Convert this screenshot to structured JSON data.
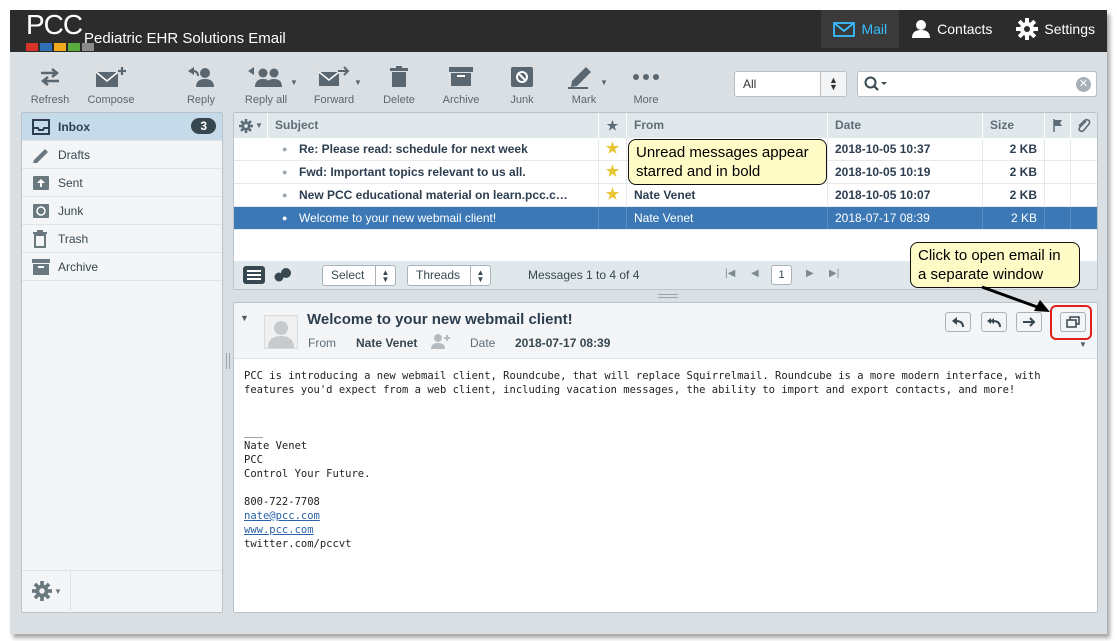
{
  "header": {
    "logo_text": "PCC",
    "logo_colors": [
      "#d9342b",
      "#2f6fb6",
      "#f0a81c",
      "#5aab3d",
      "#8a8a8a"
    ],
    "app_title": "Pediatric EHR Solutions Email",
    "nav": [
      {
        "label": "Mail",
        "icon": "envelope-icon",
        "active": true
      },
      {
        "label": "Contacts",
        "icon": "person-icon",
        "active": false
      },
      {
        "label": "Settings",
        "icon": "gear-icon",
        "active": false
      }
    ]
  },
  "toolbar": {
    "refresh": "Refresh",
    "compose": "Compose",
    "reply": "Reply",
    "reply_all": "Reply all",
    "forward": "Forward",
    "delete": "Delete",
    "archive": "Archive",
    "junk": "Junk",
    "mark": "Mark",
    "more": "More",
    "filter_value": "All",
    "search_value": ""
  },
  "sidebar": {
    "folders": [
      {
        "label": "Inbox",
        "icon": "inbox-icon",
        "unread": "3",
        "active": true
      },
      {
        "label": "Drafts",
        "icon": "pencil-icon"
      },
      {
        "label": "Sent",
        "icon": "sent-icon"
      },
      {
        "label": "Junk",
        "icon": "junk-icon"
      },
      {
        "label": "Trash",
        "icon": "trash-icon"
      },
      {
        "label": "Archive",
        "icon": "archive-icon"
      }
    ]
  },
  "list": {
    "columns": {
      "subject": "Subject",
      "from": "From",
      "date": "Date",
      "size": "Size"
    },
    "rows": [
      {
        "subject": "Re: Please read: schedule for next week",
        "from": "",
        "date": "2018-10-05 10:37",
        "size": "2 KB",
        "starred": true,
        "unread": true,
        "selected": false
      },
      {
        "subject": "Fwd: Important topics relevant to us all.",
        "from": "",
        "date": "2018-10-05 10:19",
        "size": "2 KB",
        "starred": true,
        "unread": true,
        "selected": false
      },
      {
        "subject": "New PCC educational material on learn.pcc.c…",
        "from": "Nate Venet",
        "date": "2018-10-05 10:07",
        "size": "2 KB",
        "starred": true,
        "unread": true,
        "selected": false
      },
      {
        "subject": "Welcome to your new webmail client!",
        "from": "Nate Venet",
        "date": "2018-07-17 08:39",
        "size": "2 KB",
        "starred": false,
        "unread": false,
        "selected": true
      }
    ],
    "footer": {
      "select_label": "Select",
      "threads_label": "Threads",
      "count_text": "Messages 1 to 4 of 4",
      "page": "1"
    }
  },
  "preview": {
    "subject": "Welcome to your new webmail client!",
    "from_label": "From",
    "from_name": "Nate Venet",
    "date_label": "Date",
    "date_value": "2018-07-17 08:39",
    "body_intro": "PCC is introducing a new webmail client, Roundcube, that will replace Squirrelmail. Roundcube is a more modern interface, with\nfeatures you'd expect from a web client, including vacation messages, the ability to import and export contacts, and more!",
    "signature_sep": "___",
    "sig_name": "Nate Venet",
    "sig_org": "PCC",
    "sig_tagline": "Control Your Future.",
    "sig_phone": "800-722-7708",
    "sig_email": "nate@pcc.com",
    "sig_web": "www.pcc.com",
    "sig_twitter": "twitter.com/pccvt"
  },
  "callouts": {
    "unread_note": "Unread messages appear\nstarred and in bold",
    "window_note": "Click to open email in\na separate window"
  }
}
